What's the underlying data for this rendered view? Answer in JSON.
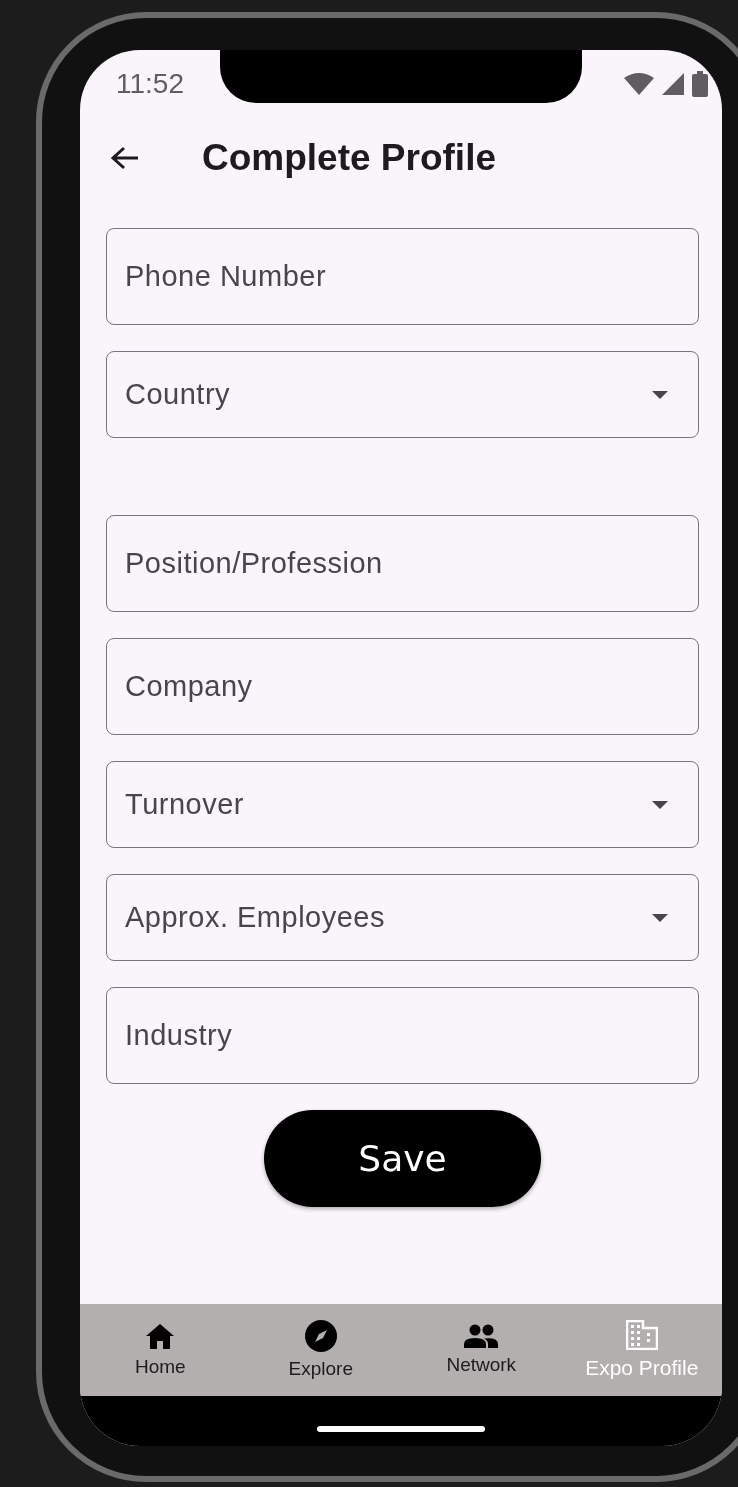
{
  "status_bar": {
    "time": "11:52"
  },
  "header": {
    "title": "Complete Profile"
  },
  "sections": [
    {
      "fields": [
        {
          "kind": "text",
          "placeholder": "Phone Number"
        },
        {
          "kind": "dropdown",
          "placeholder": "Country"
        }
      ]
    },
    {
      "fields": [
        {
          "kind": "text",
          "placeholder": "Position/Profession"
        },
        {
          "kind": "text",
          "placeholder": "Company"
        },
        {
          "kind": "dropdown",
          "placeholder": "Turnover"
        },
        {
          "kind": "dropdown",
          "placeholder": "Approx. Employees"
        },
        {
          "kind": "text",
          "placeholder": "Industry"
        }
      ]
    }
  ],
  "save_button": {
    "label": "Save"
  },
  "bottom_nav": [
    {
      "label": "Home",
      "selected": false
    },
    {
      "label": "Explore",
      "selected": false
    },
    {
      "label": "Network",
      "selected": false
    },
    {
      "label": "Expo Profile",
      "selected": true
    }
  ]
}
